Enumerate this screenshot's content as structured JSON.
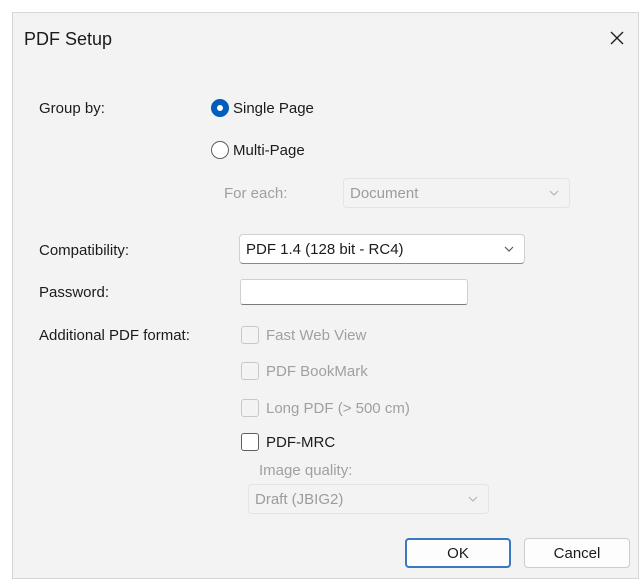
{
  "window": {
    "title": "PDF Setup"
  },
  "group_by": {
    "label": "Group by:",
    "options": [
      {
        "label": "Single Page",
        "selected": true
      },
      {
        "label": "Multi-Page",
        "selected": false
      }
    ],
    "for_each_label": "For each:",
    "for_each_value": "Document"
  },
  "compatibility": {
    "label": "Compatibility:",
    "value": "PDF 1.4 (128 bit - RC4)"
  },
  "password": {
    "label": "Password:",
    "value": ""
  },
  "additional_format": {
    "label": "Additional PDF format:",
    "options": [
      {
        "label": "Fast Web View",
        "checked": false,
        "enabled": false
      },
      {
        "label": "PDF BookMark",
        "checked": false,
        "enabled": false
      },
      {
        "label": "Long PDF (> 500 cm)",
        "checked": false,
        "enabled": false
      },
      {
        "label": "PDF-MRC",
        "checked": false,
        "enabled": true
      }
    ],
    "image_quality_label": "Image quality:",
    "image_quality_value": "Draft (JBIG2)"
  },
  "buttons": {
    "ok": "OK",
    "cancel": "Cancel"
  },
  "colors": {
    "accent": "#005fb8",
    "dialog_bg": "#f3f3f3",
    "disabled_text": "#a0a0a0"
  },
  "icons": {
    "close": "close-icon",
    "dropdown": "chevron-down-icon"
  }
}
